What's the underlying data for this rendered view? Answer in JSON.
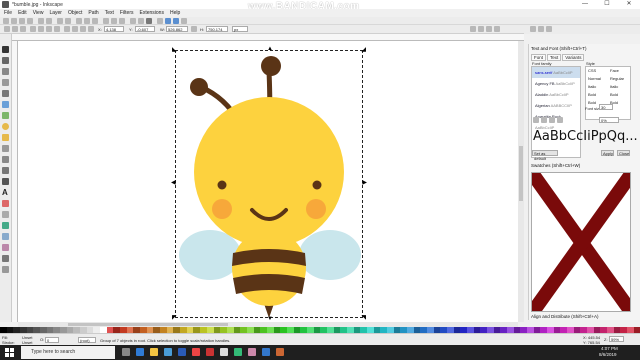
{
  "window": {
    "title": "*bumble.jpg - Inkscape",
    "min": "—",
    "max": "☐",
    "close": "✕"
  },
  "watermark": "www.BANDICAM.com",
  "menu": [
    "File",
    "Edit",
    "View",
    "Layer",
    "Object",
    "Path",
    "Text",
    "Filters",
    "Extensions",
    "Help"
  ],
  "controls": {
    "x_label": "X:",
    "x_val": "4.138",
    "y_label": "Y:",
    "y_val": "-0.607",
    "w_label": "W:",
    "w_val": "526.862",
    "h_label": "H:",
    "h_val": "750.174",
    "unit": "px"
  },
  "panel": {
    "title": "Text and Font (Shift+Ctrl+T)",
    "tabs": [
      "Font",
      "Text",
      "Variants"
    ],
    "family_label": "Font family",
    "style_label": "Style",
    "fonts": [
      "sans-serif",
      "Agency FB",
      "Aladdin",
      "Algerian",
      "Aparajita Rock"
    ],
    "font_samples": [
      "AaBbCcIiP",
      "AaBbCcIiP",
      "AaBbCcIiP",
      "AABBCCIIP",
      "AaBbCcIiP"
    ],
    "styles": [
      [
        "CSS",
        "Face"
      ],
      [
        "Normal",
        "Regular"
      ],
      [
        "Italic",
        "Italic"
      ],
      [
        "Bold",
        "Bold"
      ],
      [
        "Bold",
        "Bold"
      ]
    ],
    "font_size_label": "Font size:",
    "font_size": "30",
    "spacing": "0%",
    "preview": "AaBbCcIiPpQq...",
    "set_default": "Set as default",
    "apply": "Apply",
    "close": "Close",
    "swatches_title": "Swatches (Shift+Ctrl+W)",
    "align_title": "Align and Distribute (Shift+Ctrl+A)"
  },
  "status": {
    "fill_label": "Fill:",
    "stroke_label": "Stroke:",
    "fill_val": "Unset",
    "stroke_val": "Unset",
    "opacity_label": "O:",
    "opacity": "0",
    "layer": "(root)",
    "message": "Group of 7 objects in root. Click selection to toggle scale/rotation handles.",
    "x": "X: 445.54",
    "y": "Y: 765.54",
    "zoom_label": "Z:",
    "zoom": "59%"
  },
  "taskbar": {
    "search": "Type here to search",
    "time": "4:07 PM",
    "date": "8/6/2019"
  },
  "colors": {
    "bee_yellow": "#FDD23E",
    "bee_brown": "#5A3416",
    "wing": "#C9E6EC",
    "cheek": "#F7A83A",
    "swatch_x": "#7A0A0A"
  }
}
